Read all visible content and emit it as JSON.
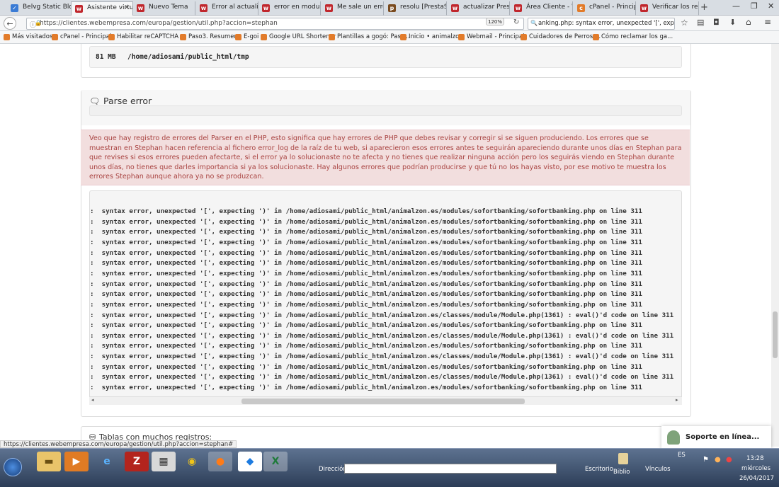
{
  "tabs": [
    {
      "label": "Belvg Static Block"
    },
    {
      "label": "Asistente virtu"
    },
    {
      "label": "Nuevo Tema"
    },
    {
      "label": "Error al actualizar"
    },
    {
      "label": "error en modulos"
    },
    {
      "label": "Me sale un error a"
    },
    {
      "label": "resolu [PrestaSho"
    },
    {
      "label": "actualizar Prestas"
    },
    {
      "label": "Área Cliente - We"
    },
    {
      "label": "cPanel - Principal"
    },
    {
      "label": "Verificar los recur"
    }
  ],
  "nav": {
    "url": "https://clientes.webempresa.com/europa/gestion/util.php?accion=stephan",
    "zoom": "120%",
    "search": "anking.php: syntax error, unexpected '[', expecting ')' in"
  },
  "bookmarks": [
    "Más visitados",
    "cPanel - Principal",
    "Habilitar reCAPTCHA ...",
    "Paso3. Resumen.",
    "E-goi",
    "Google URL Shortener",
    "Plantillas a gogó: Pasc...",
    "Inicio • animalzon",
    "Webmail - Principal",
    "Cuidadores de Perros ...",
    "Cómo reclamar los ga..."
  ],
  "tmp": {
    "size": "81 MB",
    "path": "/home/adiosami/public_html/tmp"
  },
  "parse": {
    "title": "Parse error",
    "alert": "Veo que hay registro de errores del Parser en el PHP, esto significa que hay errores de PHP que debes revisar y corregir si se siguen produciendo. Los errores que se muestran en Stephan hacen referencia al fichero error_log de la raíz de tu web, si aparecieron esos errores antes te seguirán apareciendo durante unos días en Stephan para que revises si esos errores pueden afectarte, si el error ya lo solucionaste no te afecta y no tienes que realizar ninguna acción pero los seguirás viendo en Stephan durante unos días, no tienes que darles importancia si ya los solucionaste. Hay algunos errores que podrían producirse y que tú no los hayas visto, por ese motivo te muestra los errores Stephan aunque ahora ya no se produzcan.",
    "errors": [
      ":  syntax error, unexpected '[', expecting ')' in /home/adiosami/public_html/animalzon.es/modules/sofortbanking/sofortbanking.php on line 311",
      ":  syntax error, unexpected '[', expecting ')' in /home/adiosami/public_html/animalzon.es/modules/sofortbanking/sofortbanking.php on line 311",
      ":  syntax error, unexpected '[', expecting ')' in /home/adiosami/public_html/animalzon.es/modules/sofortbanking/sofortbanking.php on line 311",
      ":  syntax error, unexpected '[', expecting ')' in /home/adiosami/public_html/animalzon.es/modules/sofortbanking/sofortbanking.php on line 311",
      ":  syntax error, unexpected '[', expecting ')' in /home/adiosami/public_html/animalzon.es/modules/sofortbanking/sofortbanking.php on line 311",
      ":  syntax error, unexpected '[', expecting ')' in /home/adiosami/public_html/animalzon.es/modules/sofortbanking/sofortbanking.php on line 311",
      ":  syntax error, unexpected '[', expecting ')' in /home/adiosami/public_html/animalzon.es/modules/sofortbanking/sofortbanking.php on line 311",
      ":  syntax error, unexpected '[', expecting ')' in /home/adiosami/public_html/animalzon.es/modules/sofortbanking/sofortbanking.php on line 311",
      ":  syntax error, unexpected '[', expecting ')' in /home/adiosami/public_html/animalzon.es/modules/sofortbanking/sofortbanking.php on line 311",
      ":  syntax error, unexpected '[', expecting ')' in /home/adiosami/public_html/animalzon.es/modules/sofortbanking/sofortbanking.php on line 311",
      ":  syntax error, unexpected '[', expecting ')' in /home/adiosami/public_html/animalzon.es/classes/module/Module.php(1361) : eval()'d code on line 311",
      ":  syntax error, unexpected '[', expecting ')' in /home/adiosami/public_html/animalzon.es/modules/sofortbanking/sofortbanking.php on line 311",
      ":  syntax error, unexpected '[', expecting ')' in /home/adiosami/public_html/animalzon.es/classes/module/Module.php(1361) : eval()'d code on line 311",
      ":  syntax error, unexpected '[', expecting ')' in /home/adiosami/public_html/animalzon.es/modules/sofortbanking/sofortbanking.php on line 311",
      ":  syntax error, unexpected '[', expecting ')' in /home/adiosami/public_html/animalzon.es/classes/module/Module.php(1361) : eval()'d code on line 311",
      ":  syntax error, unexpected '[', expecting ')' in /home/adiosami/public_html/animalzon.es/modules/sofortbanking/sofortbanking.php on line 311",
      ":  syntax error, unexpected '[', expecting ')' in /home/adiosami/public_html/animalzon.es/classes/module/Module.php(1361) : eval()'d code on line 311",
      ":  syntax error, unexpected '[', expecting ')' in /home/adiosami/public_html/animalzon.es/modules/sofortbanking/sofortbanking.php on line 311"
    ]
  },
  "next_section": "Tablas con muchos registros:",
  "status_url": "https://clientes.webempresa.com/europa/gestion/util.php?accion=stephan#",
  "support": "Soporte en línea...",
  "taskbar": {
    "direccion": "Dirección",
    "escritorio": "Escritorio",
    "biblio": "Biblio",
    "vinculos": "Vínculos",
    "lang": "ES",
    "time": "13:28",
    "day": "miércoles",
    "date": "26/04/2017"
  }
}
